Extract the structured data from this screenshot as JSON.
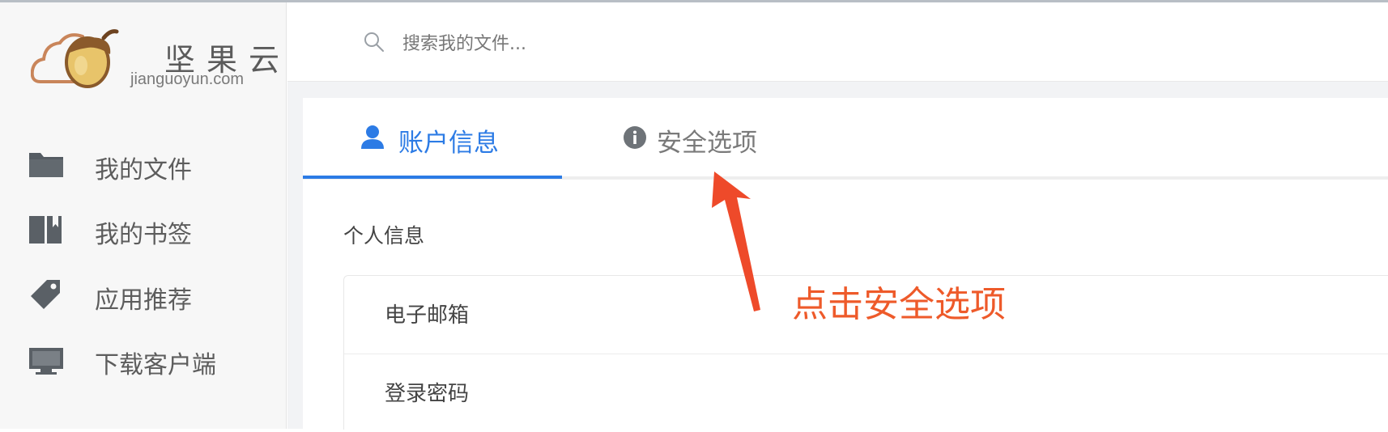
{
  "brand": {
    "name_cn": "坚果云",
    "domain": "jianguoyun.com"
  },
  "search": {
    "placeholder": "搜索我的文件..."
  },
  "sidebar": {
    "items": [
      {
        "label": "我的文件",
        "icon": "folder-icon"
      },
      {
        "label": "我的书签",
        "icon": "bookmark-icon"
      },
      {
        "label": "应用推荐",
        "icon": "tag-icon"
      },
      {
        "label": "下载客户端",
        "icon": "monitor-icon"
      }
    ]
  },
  "tabs": [
    {
      "label": "账户信息",
      "icon": "user-icon",
      "active": true
    },
    {
      "label": "安全选项",
      "icon": "info-icon",
      "active": false
    }
  ],
  "main": {
    "section_title": "个人信息",
    "rows": [
      {
        "label": "电子邮箱"
      },
      {
        "label": "登录密码"
      }
    ]
  },
  "annotation": {
    "text": "点击安全选项",
    "color": "#ee5a2a"
  },
  "colors": {
    "accent": "#2c7be5",
    "annotation": "#ee5a2a",
    "sidebar_bg": "#f7f7f7"
  }
}
